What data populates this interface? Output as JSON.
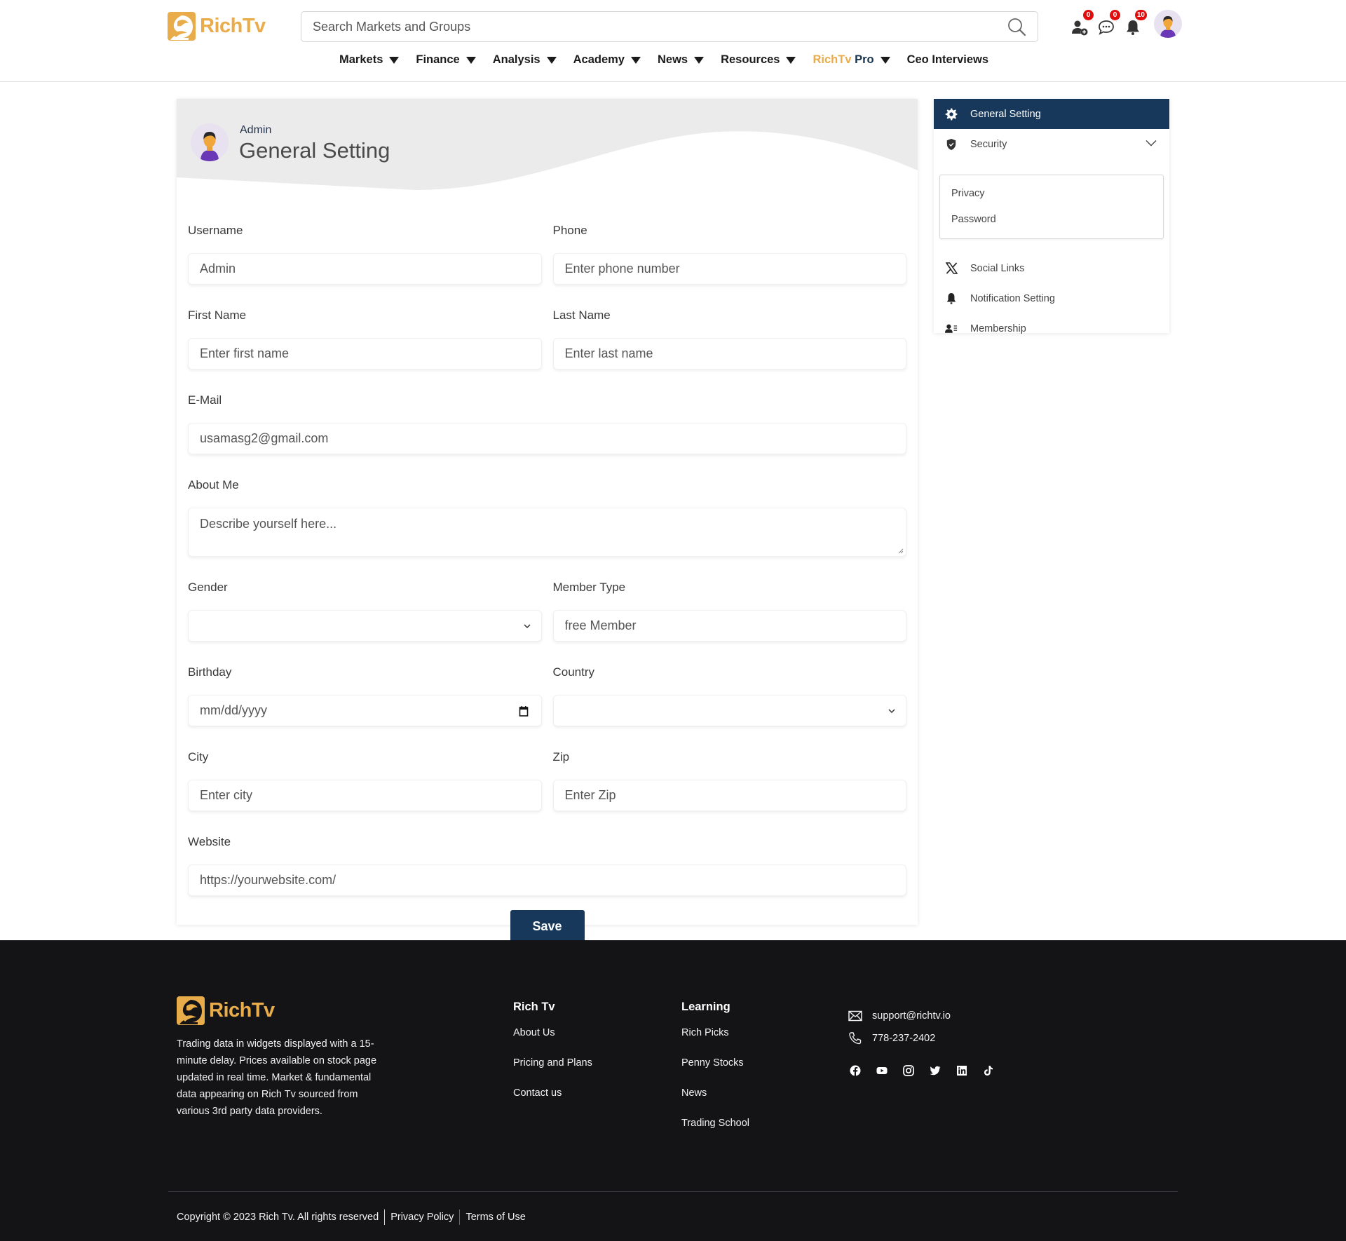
{
  "brand": {
    "name": "RichTv",
    "accent": "#e9ac4b",
    "primary": "#17385a"
  },
  "header": {
    "search_placeholder": "Search Markets and Groups",
    "icons": [
      {
        "name": "friend-requests",
        "badge": "0"
      },
      {
        "name": "messages",
        "badge": "0"
      },
      {
        "name": "notifications",
        "badge": "10"
      }
    ],
    "nav": [
      {
        "label": "Markets",
        "dropdown": true
      },
      {
        "label": "Finance",
        "dropdown": true
      },
      {
        "label": "Analysis",
        "dropdown": true
      },
      {
        "label": "Academy",
        "dropdown": true
      },
      {
        "label": "News",
        "dropdown": true
      },
      {
        "label": "Resources",
        "dropdown": true
      },
      {
        "label_a": "RichTv",
        "label_b": " Pro",
        "dropdown": true
      },
      {
        "label": "Ceo Interviews",
        "dropdown": false
      }
    ]
  },
  "profile": {
    "role": "Admin",
    "title": "General Setting"
  },
  "form": {
    "username": {
      "label": "Username",
      "value": "Admin",
      "placeholder": ""
    },
    "phone": {
      "label": "Phone",
      "value": "",
      "placeholder": "Enter phone number"
    },
    "first_name": {
      "label": "First Name",
      "value": "",
      "placeholder": "Enter first name"
    },
    "last_name": {
      "label": "Last Name",
      "value": "",
      "placeholder": "Enter last name"
    },
    "email": {
      "label": "E-Mail",
      "value": "usamasg2@gmail.com",
      "placeholder": ""
    },
    "about": {
      "label": "About Me",
      "value": "",
      "placeholder": "Describe yourself here..."
    },
    "gender": {
      "label": "Gender",
      "value": ""
    },
    "member_type": {
      "label": "Member Type",
      "value": "free Member"
    },
    "birthday": {
      "label": "Birthday",
      "value": "",
      "placeholder": "mm/dd/yyyy"
    },
    "country": {
      "label": "Country",
      "value": ""
    },
    "city": {
      "label": "City",
      "value": "",
      "placeholder": "Enter city"
    },
    "zip": {
      "label": "Zip",
      "value": "",
      "placeholder": "Enter Zip"
    },
    "website": {
      "label": "Website",
      "value": "https://yourwebsite.com/",
      "placeholder": ""
    },
    "save_label": "Save"
  },
  "sidebar": {
    "items": [
      {
        "label": "General Setting",
        "icon": "gear-icon",
        "active": true
      },
      {
        "label": "Security",
        "icon": "shield-icon",
        "expanded": true
      },
      {
        "label": "Social Links",
        "icon": "x-logo-icon"
      },
      {
        "label": "Notification Setting",
        "icon": "bell-icon"
      },
      {
        "label": "Membership",
        "icon": "member-card-icon"
      }
    ],
    "security_sub": [
      "Privacy",
      "Password"
    ]
  },
  "footer": {
    "about": "Trading data in widgets displayed with a 15-minute delay. Prices available on stock page updated in real time. Market & fundamental data appearing on Rich Tv sourced from various 3rd party data providers.",
    "col1": {
      "title": "Rich Tv",
      "links": [
        "About Us",
        "Pricing and Plans",
        "Contact us"
      ]
    },
    "col2": {
      "title": "Learning",
      "links": [
        "Rich Picks",
        "Penny Stocks",
        "News",
        "Trading School"
      ]
    },
    "email": "support@richtv.io",
    "phone": "778-237-2402",
    "social": [
      "facebook-icon",
      "youtube-icon",
      "instagram-icon",
      "twitter-icon",
      "linkedin-icon",
      "tiktok-icon"
    ],
    "copyright": "Copyright © 2023 Rich Tv. All rights reserved",
    "privacy": "Privacy Policy",
    "terms": "Terms of Use"
  }
}
